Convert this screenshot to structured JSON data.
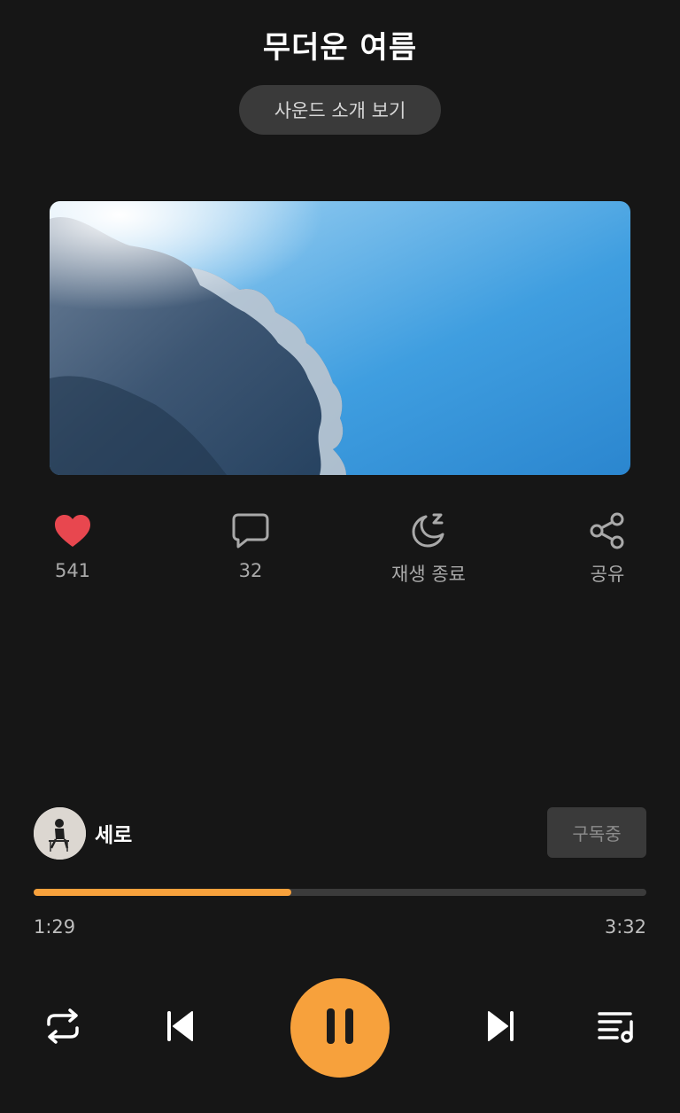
{
  "header": {
    "title": "무더운 여름",
    "intro_button": "사운드 소개 보기"
  },
  "cover": {
    "image": "sky-clouds-image"
  },
  "actions": [
    {
      "icon": "heart-icon",
      "label": "541",
      "color": "#e8474f"
    },
    {
      "icon": "comment-icon",
      "label": "32"
    },
    {
      "icon": "sleep-timer-icon",
      "label": "재생 종료"
    },
    {
      "icon": "share-icon",
      "label": "공유"
    }
  ],
  "artist": {
    "name": "세로",
    "subscribe_label": "구독중"
  },
  "player": {
    "progress": 0.42,
    "current_time": "1:29",
    "total_time": "3:32",
    "accent": "#f7a13c"
  },
  "controls": {
    "repeat": "repeat-icon",
    "previous": "skip-previous-icon",
    "play_pause": "pause-icon",
    "next": "skip-next-icon",
    "playlist": "playlist-icon"
  }
}
